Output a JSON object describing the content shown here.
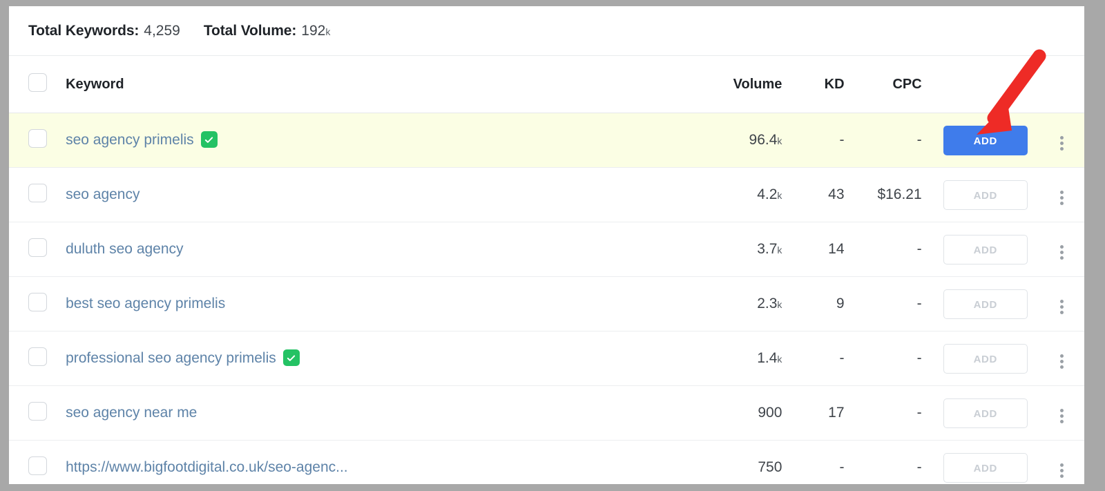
{
  "summary": {
    "keywords_label": "Total Keywords:",
    "keywords_value": "4,259",
    "volume_label": "Total Volume:",
    "volume_value": "192",
    "volume_unit": "k"
  },
  "table": {
    "headers": {
      "keyword": "Keyword",
      "volume": "Volume",
      "kd": "KD",
      "cpc": "CPC",
      "action": "",
      "menu": ""
    },
    "rows": [
      {
        "keyword": "seo agency primelis",
        "verified": true,
        "volume": "96.4",
        "volume_unit": "k",
        "kd": "-",
        "cpc": "-",
        "add_label": "ADD",
        "add_state": "primary",
        "highlighted": true
      },
      {
        "keyword": "seo agency",
        "verified": false,
        "volume": "4.2",
        "volume_unit": "k",
        "kd": "43",
        "cpc": "$16.21",
        "add_label": "ADD",
        "add_state": "ghost",
        "highlighted": false
      },
      {
        "keyword": "duluth seo agency",
        "verified": false,
        "volume": "3.7",
        "volume_unit": "k",
        "kd": "14",
        "cpc": "-",
        "add_label": "ADD",
        "add_state": "ghost",
        "highlighted": false
      },
      {
        "keyword": "best seo agency primelis",
        "verified": false,
        "volume": "2.3",
        "volume_unit": "k",
        "kd": "9",
        "cpc": "-",
        "add_label": "ADD",
        "add_state": "ghost",
        "highlighted": false
      },
      {
        "keyword": "professional seo agency primelis",
        "verified": true,
        "volume": "1.4",
        "volume_unit": "k",
        "kd": "-",
        "cpc": "-",
        "add_label": "ADD",
        "add_state": "ghost",
        "highlighted": false
      },
      {
        "keyword": "seo agency near me",
        "verified": false,
        "volume": "900",
        "volume_unit": "",
        "kd": "17",
        "cpc": "-",
        "add_label": "ADD",
        "add_state": "ghost",
        "highlighted": false
      },
      {
        "keyword": "https://www.bigfootdigital.co.uk/seo-agenc...",
        "verified": false,
        "volume": "750",
        "volume_unit": "",
        "kd": "-",
        "cpc": "-",
        "add_label": "ADD",
        "add_state": "ghost",
        "highlighted": false
      }
    ]
  },
  "annotation": {
    "arrow_color": "#ee2b26",
    "arrow_target": "add-button-row-0"
  },
  "colors": {
    "primary_button": "#3f7ceb",
    "verified_badge": "#24c264",
    "link": "#5e83a8",
    "row_highlight": "#fbfee4",
    "frame": "#a8a8a8"
  }
}
